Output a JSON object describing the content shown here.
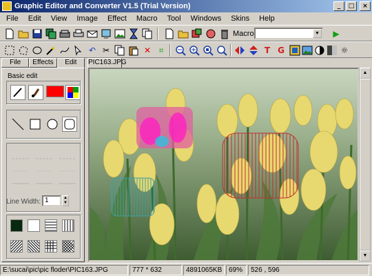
{
  "window": {
    "title": "Graphic Editor and Converter V1.5 (Trial Version)",
    "controls": [
      "_",
      "□",
      "×"
    ]
  },
  "menu": [
    "File",
    "Edit",
    "View",
    "Image",
    "Effect",
    "Macro",
    "Tool",
    "Windows",
    "Skins",
    "Help"
  ],
  "toolbar1": {
    "macro_label": "Macro:",
    "macro_value": "",
    "icons": [
      "new-file-icon",
      "open-folder-icon",
      "save-icon",
      "save-all-icon",
      "print-icon",
      "scan-icon",
      "email-icon",
      "capture-icon",
      "image-icon",
      "hourglass-icon",
      "copy-icon",
      "document-icon",
      "folder-open-icon",
      "batch-icon",
      "convert-icon",
      "delete-icon",
      "run-macro-icon"
    ]
  },
  "toolbar2": {
    "icons": [
      "rect-select-icon",
      "lasso-select-icon",
      "ellipse-select-icon",
      "magic-wand-icon",
      "freehand-icon",
      "select-icon",
      "undo-icon",
      "cut-icon",
      "copy-icon",
      "paste-icon",
      "delete-icon",
      "crop-icon",
      "zoom-out-icon",
      "zoom-in-icon",
      "zoom-fit-icon",
      "zoom-actual-icon",
      "flip-horizontal-icon",
      "flip-vertical-icon",
      "text-icon",
      "rotate-icon",
      "resize-icon",
      "picture-icon",
      "contrast-icon",
      "grayscale-icon",
      "brightness-icon"
    ]
  },
  "left_panel": {
    "tabs": [
      "File",
      "Effects",
      "Edit"
    ],
    "active_tab": "Edit",
    "title": "Basic edit",
    "line_width_label": "Line Width:",
    "line_width_value": "1",
    "colors": {
      "fill": "#ff0000"
    }
  },
  "document": {
    "tab_label": "PIC163.JPG"
  },
  "status": {
    "path": "E:\\sucai\\pic\\pic floder\\PIC163.JPG",
    "dimensions": "777 * 632",
    "size": "4891065KB",
    "zoom": "69%",
    "cursor": "526 , 596"
  }
}
